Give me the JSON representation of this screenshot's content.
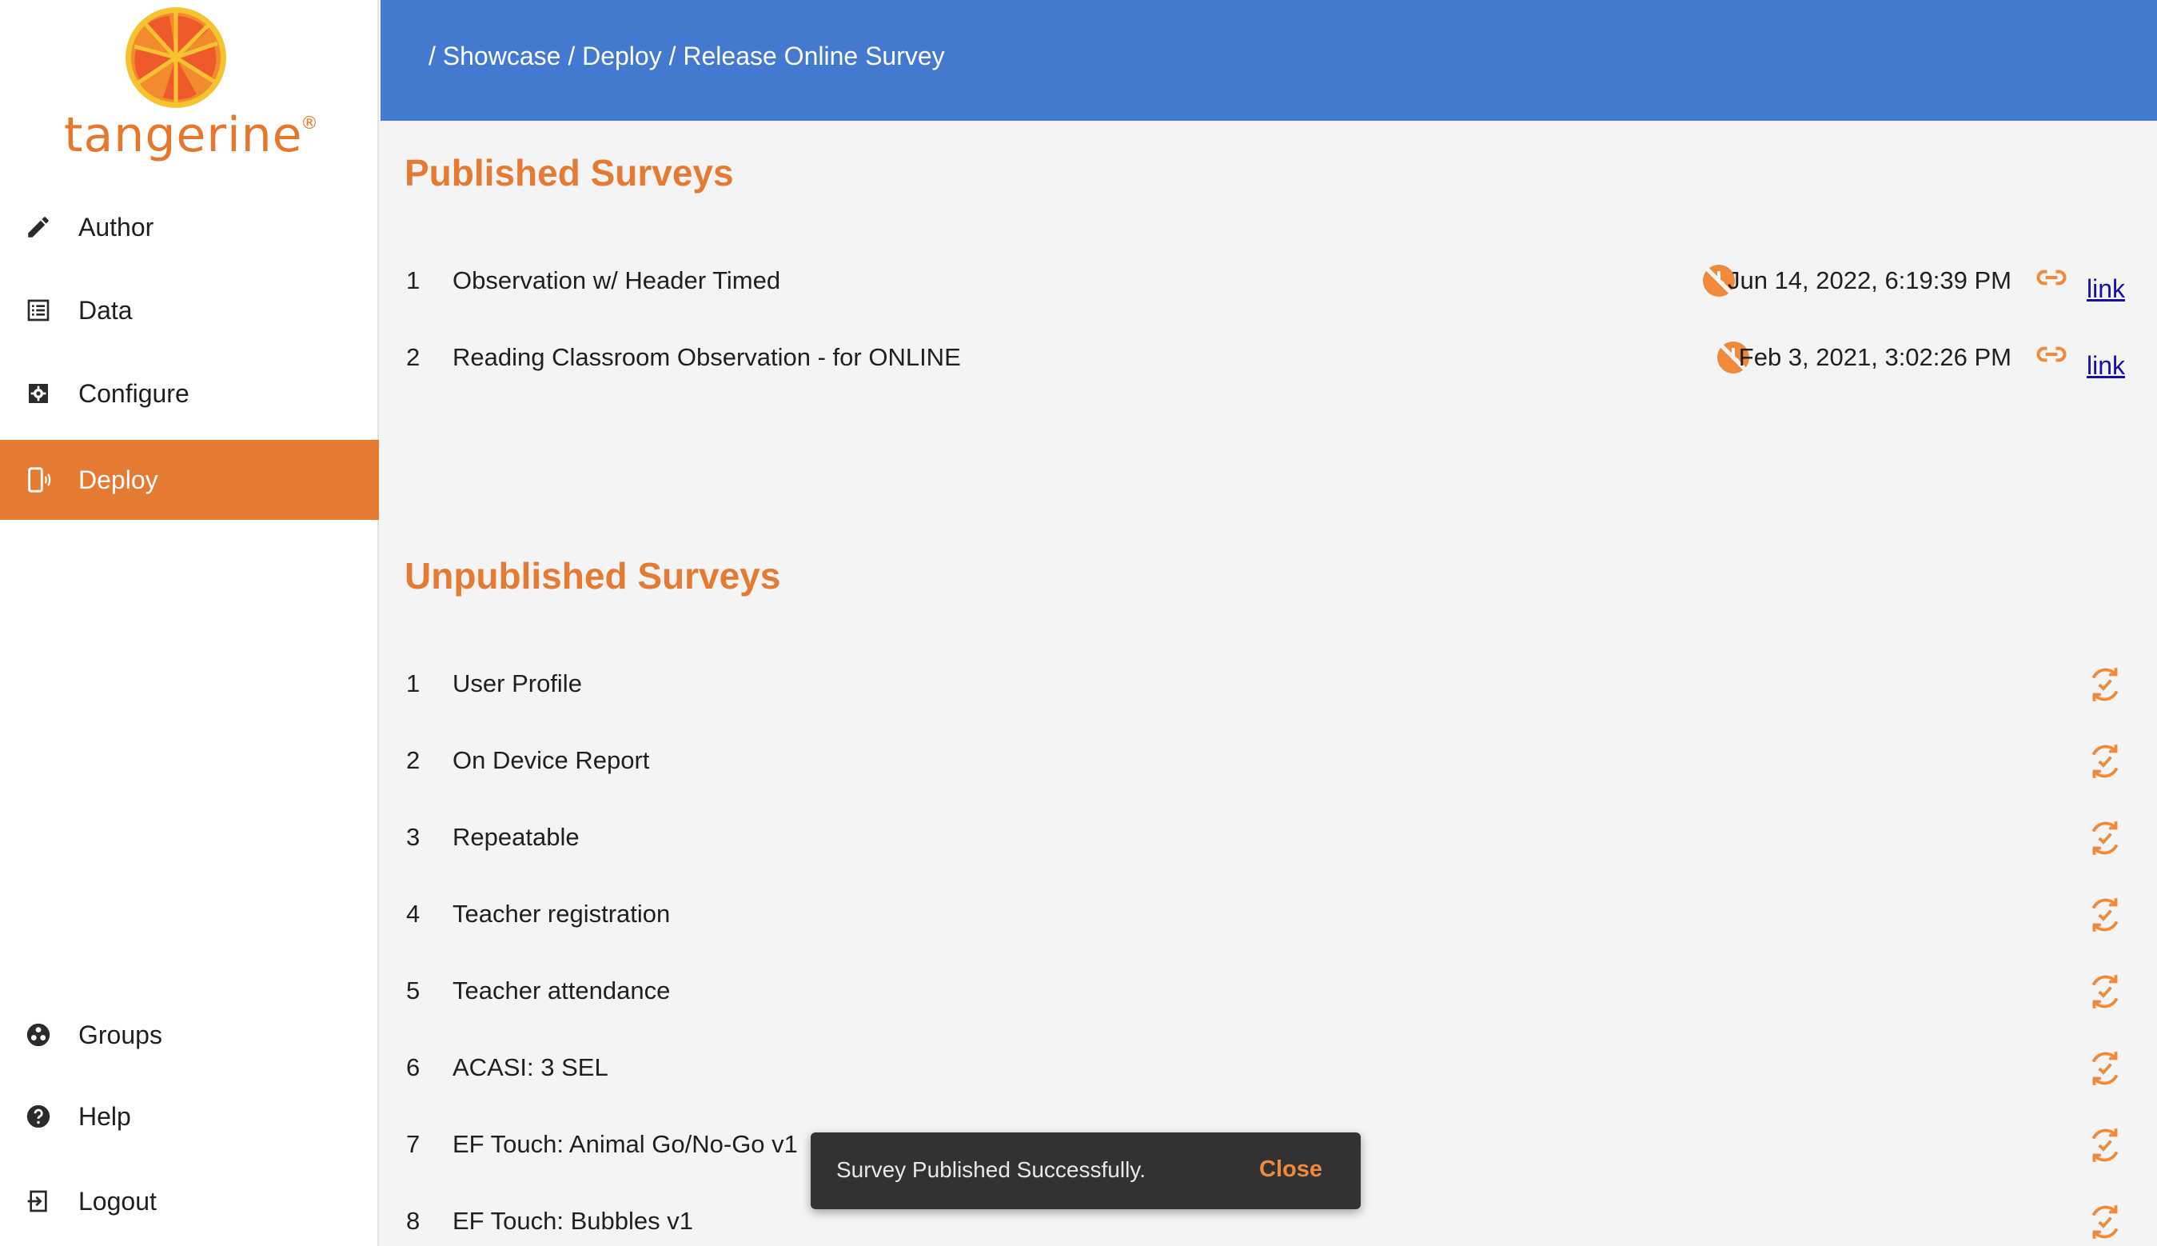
{
  "app": {
    "brand": "tangerine",
    "brand_mark": "®",
    "accent_color": "#e57a33",
    "header_color": "#4479d0"
  },
  "sidebar": {
    "items": [
      {
        "label": "Author",
        "icon": "pencil-icon",
        "active": false
      },
      {
        "label": "Data",
        "icon": "list-icon",
        "active": false
      },
      {
        "label": "Configure",
        "icon": "settings-icon",
        "active": false
      },
      {
        "label": "Deploy",
        "icon": "device-icon",
        "active": true
      }
    ],
    "bottom_items": [
      {
        "label": "Groups",
        "icon": "groups-icon"
      },
      {
        "label": "Help",
        "icon": "help-icon"
      },
      {
        "label": "Logout",
        "icon": "logout-icon"
      }
    ]
  },
  "header": {
    "breadcrumb": "/ Showcase / Deploy / Release Online Survey"
  },
  "published": {
    "heading": "Published Surveys",
    "rows": [
      {
        "num": "1",
        "title": "Observation w/ Header Timed",
        "date": "Jun 14, 2022, 6:19:39 PM",
        "link": "link"
      },
      {
        "num": "2",
        "title": "Reading Classroom Observation - for ONLINE",
        "date": "Feb 3, 2021, 3:02:26 PM",
        "link": "link"
      }
    ]
  },
  "unpublished": {
    "heading": "Unpublished Surveys",
    "rows": [
      {
        "num": "1",
        "title": "User Profile"
      },
      {
        "num": "2",
        "title": "On Device Report"
      },
      {
        "num": "3",
        "title": "Repeatable"
      },
      {
        "num": "4",
        "title": "Teacher registration"
      },
      {
        "num": "5",
        "title": "Teacher attendance"
      },
      {
        "num": "6",
        "title": "ACASI: 3 SEL"
      },
      {
        "num": "7",
        "title": "EF Touch: Animal Go/No-Go v1"
      },
      {
        "num": "8",
        "title": "EF Touch: Bubbles v1"
      }
    ]
  },
  "snackbar": {
    "message": "Survey Published Successfully.",
    "action": "Close"
  }
}
